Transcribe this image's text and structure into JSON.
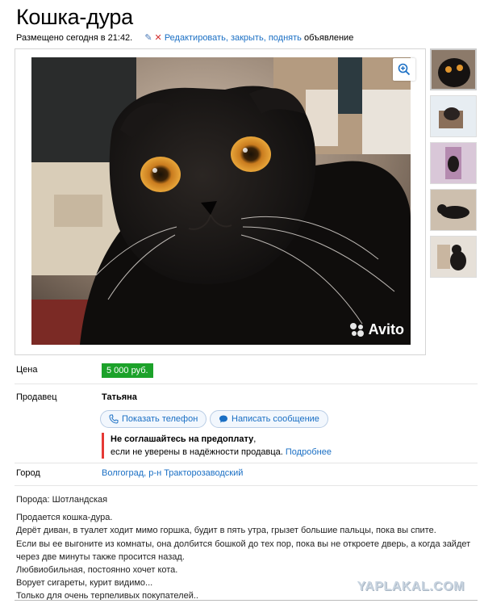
{
  "listing": {
    "title": "Кошка-дура",
    "posted": "Размещено сегодня в 21:42.",
    "actions": {
      "edit": "Редактировать",
      "comma1": ",",
      "close": "закрыть",
      "comma2": ",",
      "raise": "поднять",
      "suffix": "объявление"
    }
  },
  "gallery": {
    "watermark": "Avito",
    "icons": {
      "zoom": "zoom-in-icon",
      "pencil": "pencil-icon",
      "cross": "close-icon"
    }
  },
  "price": {
    "label": "Цена",
    "value": "5 000 руб."
  },
  "seller": {
    "label": "Продавец",
    "name": "Татьяна",
    "phone_button": "Показать телефон",
    "message_button": "Написать сообщение",
    "warning_title": "Не соглашайтесь на предоплату",
    "warning_comma": ",",
    "warning_text": "если не уверены в надёжности продавца.",
    "warning_link": "Подробнее"
  },
  "city": {
    "label": "Город",
    "value": "Волгоград, р-н Тракторозаводский"
  },
  "description": {
    "breed": "Порода: Шотландская",
    "lines": [
      "Продается кошка-дура.",
      "Дерёт диван, в туалет ходит мимо горшка, будит в пять утра, грызет большие пальцы, пока вы спите.",
      "Если вы ее выгоните из комнаты, она долбится бошкой до тех пор, пока вы не откроете дверь, а когда зайдет",
      "через две минуты также просится назад.",
      "Любвиобильная, постоянно хочет кота.",
      "Ворует сигареты, курит видимо...",
      "Только для очень терпеливых покупателей.."
    ]
  },
  "site_watermark": "YAPLAKAL.COM",
  "colors": {
    "link": "#1a6fc4",
    "price_bg": "#1ca22a",
    "warning_bar": "#e53935"
  }
}
